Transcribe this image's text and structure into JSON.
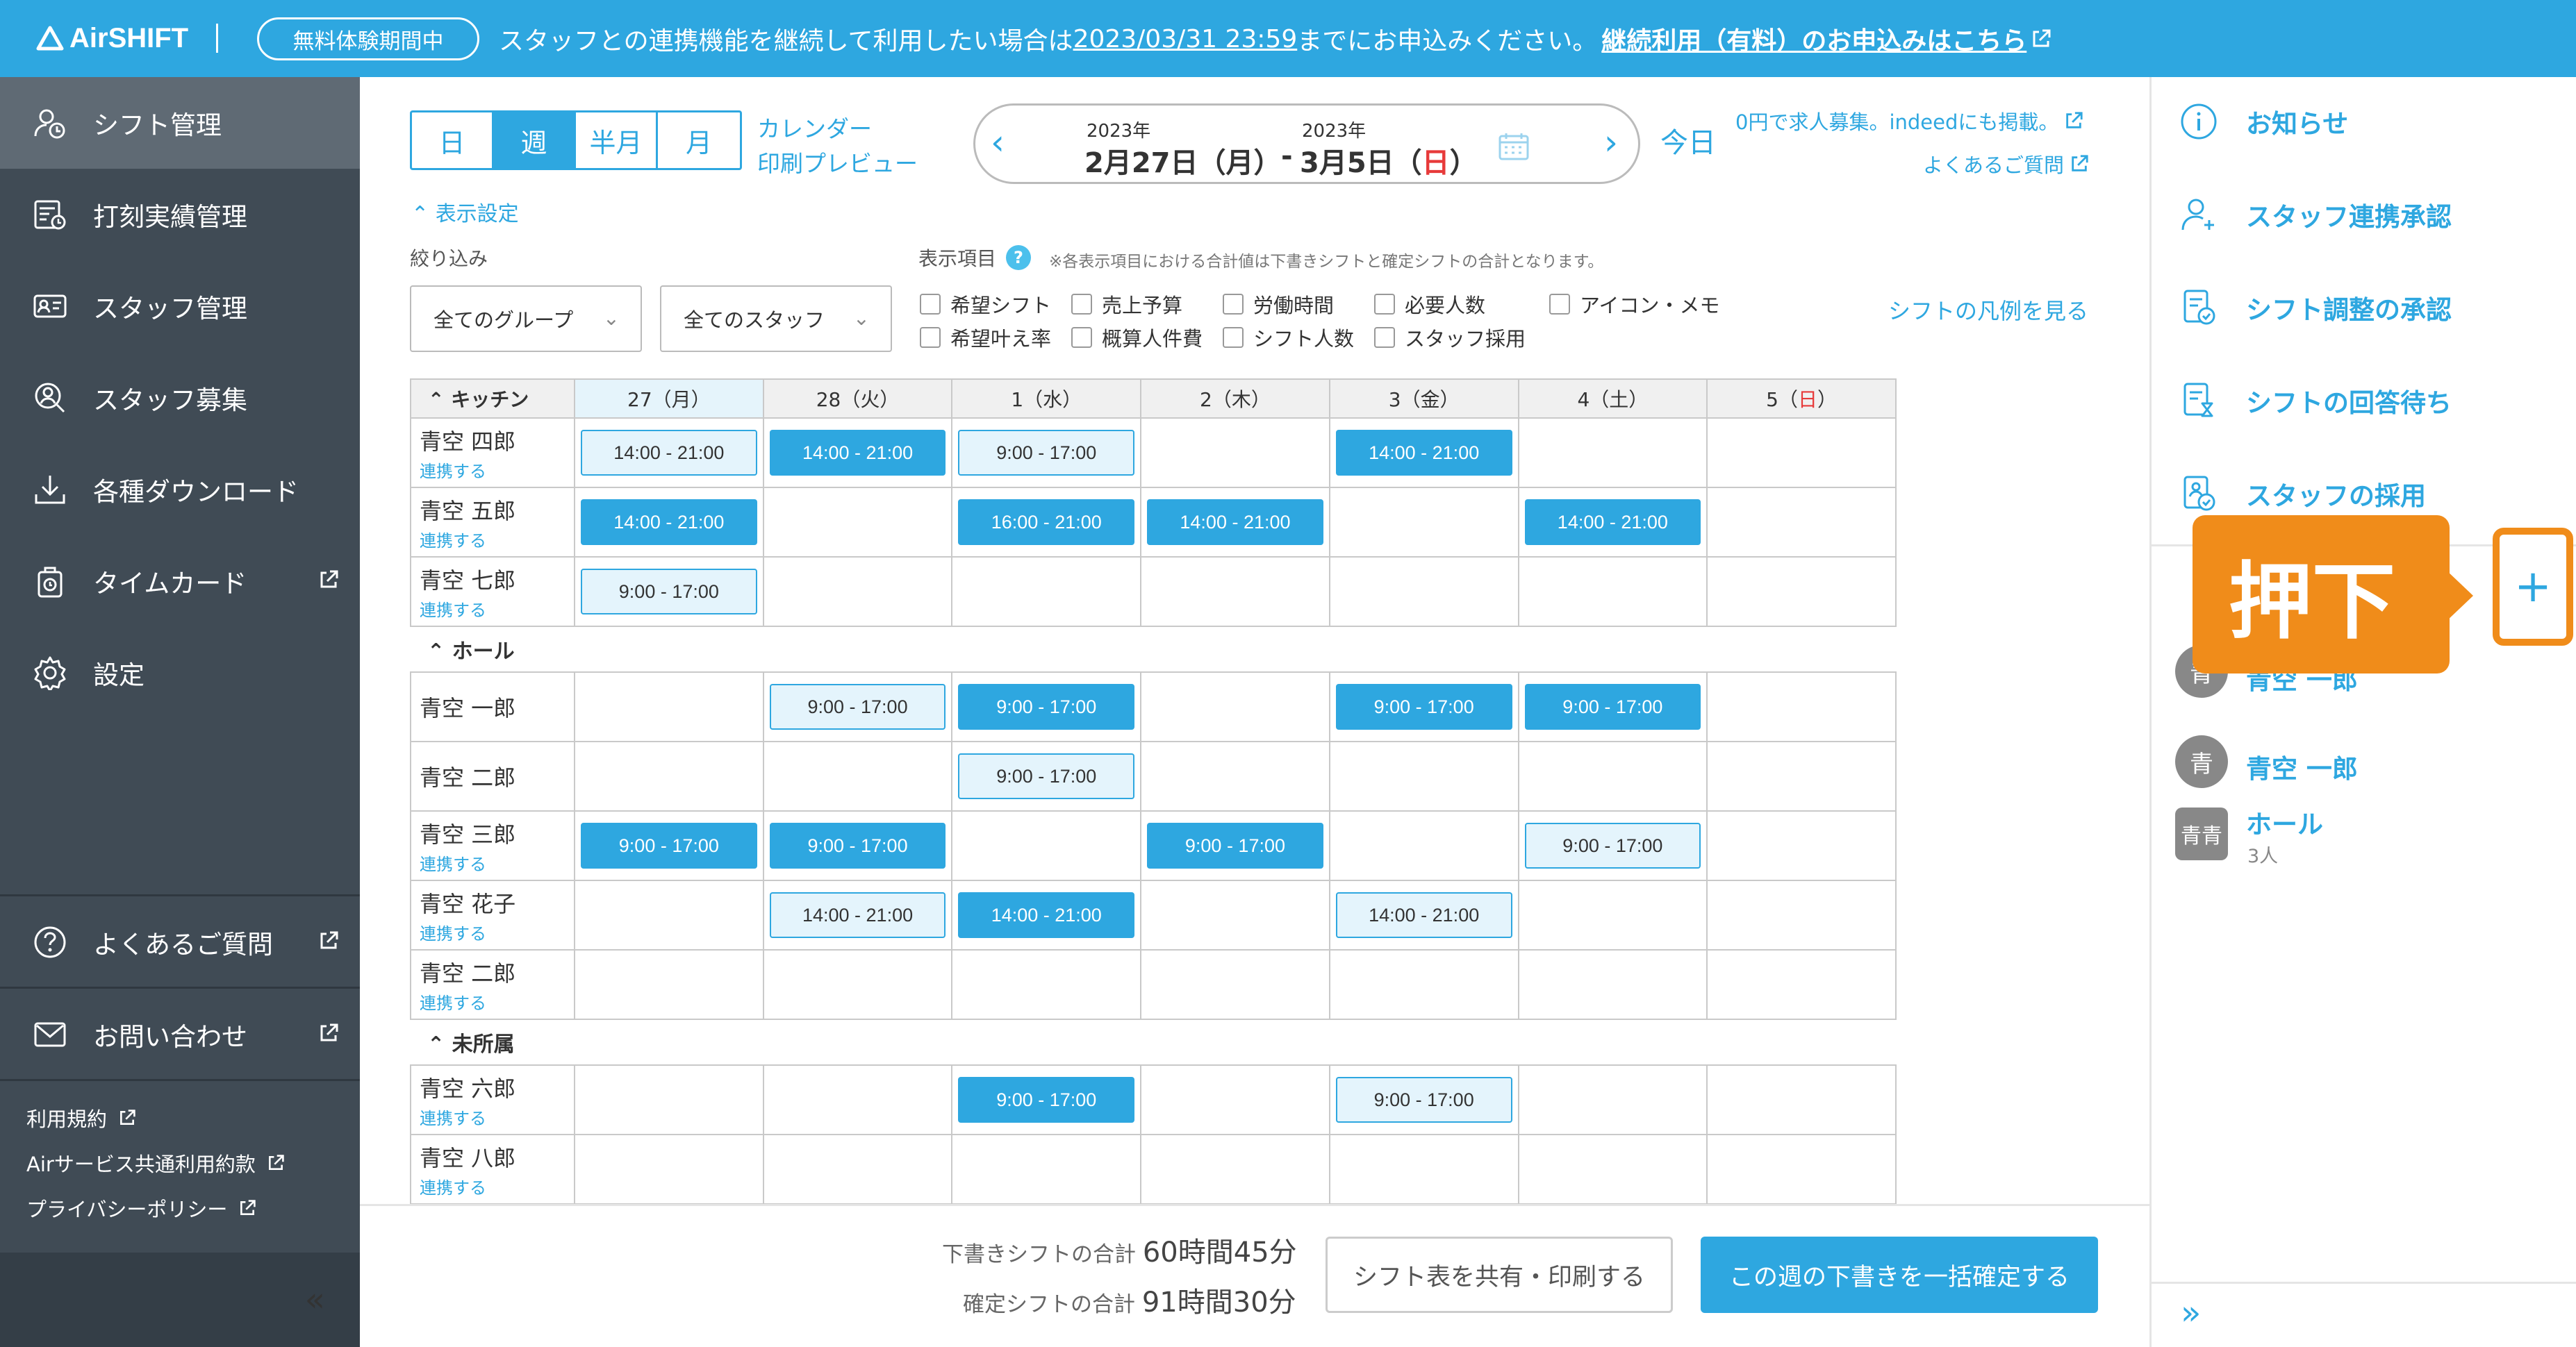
{
  "topbar": {
    "logo": "AirSHIFT",
    "trial_badge": "無料体験期間中",
    "notice_pre": "スタッフとの連携機能を継続して利用したい場合は",
    "notice_date": "2023/03/31 23:59",
    "notice_post": "までにお申込みください。",
    "notice_link": "継続利用（有料）のお申込みはこちら"
  },
  "sidebar": {
    "items": [
      {
        "label": "シフト管理"
      },
      {
        "label": "打刻実績管理"
      },
      {
        "label": "スタッフ管理"
      },
      {
        "label": "スタッフ募集"
      },
      {
        "label": "各種ダウンロード"
      },
      {
        "label": "タイムカード"
      },
      {
        "label": "設定"
      }
    ],
    "faq": "よくあるご質問",
    "contact": "お問い合わせ",
    "terms": "利用規約",
    "air_terms": "Airサービス共通利用約款",
    "privacy": "プライバシーポリシー",
    "collapse": "«"
  },
  "toolbar": {
    "view_day": "日",
    "view_week": "週",
    "view_half": "半月",
    "view_month": "月",
    "calendar_print_1": "カレンダー",
    "calendar_print_2": "印刷プレビュー",
    "prev": "‹",
    "next": "›",
    "start_year": "2023年",
    "start_date": "2月27日（月）",
    "dash": "-",
    "end_year": "2023年",
    "end_date_pre": "3月5日（",
    "end_date_day": "日",
    "end_date_post": "）",
    "today": "今日",
    "indeed_link": "0円で求人募集。indeedにも掲載。",
    "faq_link": "よくあるご質問"
  },
  "filters": {
    "toggle": "表示設定",
    "filter_label": "絞り込み",
    "group_select": "全てのグループ",
    "staff_select": "全てのスタッフ",
    "display_label": "表示項目",
    "display_note": "※各表示項目における合計値は下書きシフトと確定シフトの合計となります。",
    "checkboxes": [
      "希望シフト",
      "売上予算",
      "労働時間",
      "必要人数",
      "アイコン・メモ",
      "希望叶え率",
      "概算人件費",
      "シフト人数",
      "スタッフ採用"
    ],
    "legend_link": "シフトの凡例を見る"
  },
  "schedule": {
    "days": [
      "27（月）",
      "28（火）",
      "1（水）",
      "2（木）",
      "3（金）",
      "4（土）",
      "5（"
    ],
    "day_sun_red": "日",
    "day_sun_close": "）",
    "link_label": "連携する",
    "groups": [
      {
        "name": "キッチン",
        "rows": [
          {
            "name": "青空 四郎",
            "link": true,
            "cells": [
              {
                "t": "14:00 - 21:00",
                "s": "d"
              },
              {
                "t": "14:00 - 21:00",
                "s": "c"
              },
              {
                "t": "9:00 - 17:00",
                "s": "d"
              },
              null,
              {
                "t": "14:00 - 21:00",
                "s": "c"
              },
              null,
              null
            ]
          },
          {
            "name": "青空 五郎",
            "link": true,
            "cells": [
              {
                "t": "14:00 - 21:00",
                "s": "c"
              },
              null,
              {
                "t": "16:00 - 21:00",
                "s": "c"
              },
              {
                "t": "14:00 - 21:00",
                "s": "c"
              },
              null,
              {
                "t": "14:00 - 21:00",
                "s": "c"
              },
              null
            ]
          },
          {
            "name": "青空 七郎",
            "link": true,
            "cells": [
              {
                "t": "9:00 - 17:00",
                "s": "d"
              },
              null,
              null,
              null,
              null,
              null,
              null
            ]
          }
        ]
      },
      {
        "name": "ホール",
        "rows": [
          {
            "name": "青空 一郎",
            "link": false,
            "cells": [
              null,
              {
                "t": "9:00 - 17:00",
                "s": "d"
              },
              {
                "t": "9:00 - 17:00",
                "s": "c"
              },
              null,
              {
                "t": "9:00 - 17:00",
                "s": "c"
              },
              {
                "t": "9:00 - 17:00",
                "s": "c"
              },
              null
            ]
          },
          {
            "name": "青空 二郎",
            "link": false,
            "cells": [
              null,
              null,
              {
                "t": "9:00 - 17:00",
                "s": "d"
              },
              null,
              null,
              null,
              null
            ]
          },
          {
            "name": "青空 三郎",
            "link": true,
            "cells": [
              {
                "t": "9:00 - 17:00",
                "s": "c"
              },
              {
                "t": "9:00 - 17:00",
                "s": "c"
              },
              null,
              {
                "t": "9:00 - 17:00",
                "s": "c"
              },
              null,
              {
                "t": "9:00 - 17:00",
                "s": "d"
              },
              null
            ]
          },
          {
            "name": "青空 花子",
            "link": true,
            "cells": [
              null,
              {
                "t": "14:00 - 21:00",
                "s": "d"
              },
              {
                "t": "14:00 - 21:00",
                "s": "c"
              },
              null,
              {
                "t": "14:00 - 21:00",
                "s": "d"
              },
              null,
              null
            ]
          },
          {
            "name": "青空 二郎",
            "link": true,
            "cells": [
              null,
              null,
              null,
              null,
              null,
              null,
              null
            ]
          }
        ]
      },
      {
        "name": "未所属",
        "rows": [
          {
            "name": "青空 六郎",
            "link": true,
            "cells": [
              null,
              null,
              {
                "t": "9:00 - 17:00",
                "s": "c"
              },
              null,
              {
                "t": "9:00 - 17:00",
                "s": "d"
              },
              null,
              null
            ]
          },
          {
            "name": "青空 八郎",
            "link": true,
            "cells": [
              null,
              null,
              null,
              null,
              null,
              null,
              null
            ]
          }
        ]
      }
    ]
  },
  "footer": {
    "draft_label": "下書きシフトの合計",
    "draft_value": "60時間45分",
    "confirmed_label": "確定シフトの合計",
    "confirmed_value": "91時間30分",
    "share_button": "シフト表を共有・印刷する",
    "confirm_button": "この週の下書きを一括確定する"
  },
  "right_panel": {
    "items": [
      "お知らせ",
      "スタッフ連携承認",
      "シフト調整の承認",
      "シフトの回答待ち",
      "スタッフの採用"
    ],
    "users": [
      {
        "avatar": "青",
        "name": "青空 一郎"
      },
      {
        "avatar": "青",
        "name": "青空 一郎"
      }
    ],
    "group": {
      "avatar": "青青",
      "name": "ホール",
      "count": "3人"
    },
    "expand": "»",
    "plus": "+"
  },
  "annotation": {
    "callout": "押下"
  },
  "colors": {
    "accent": "#2ea7e0",
    "sidebar": "#404b55",
    "callout": "#f08c1a",
    "sunday": "#e73a3a"
  }
}
